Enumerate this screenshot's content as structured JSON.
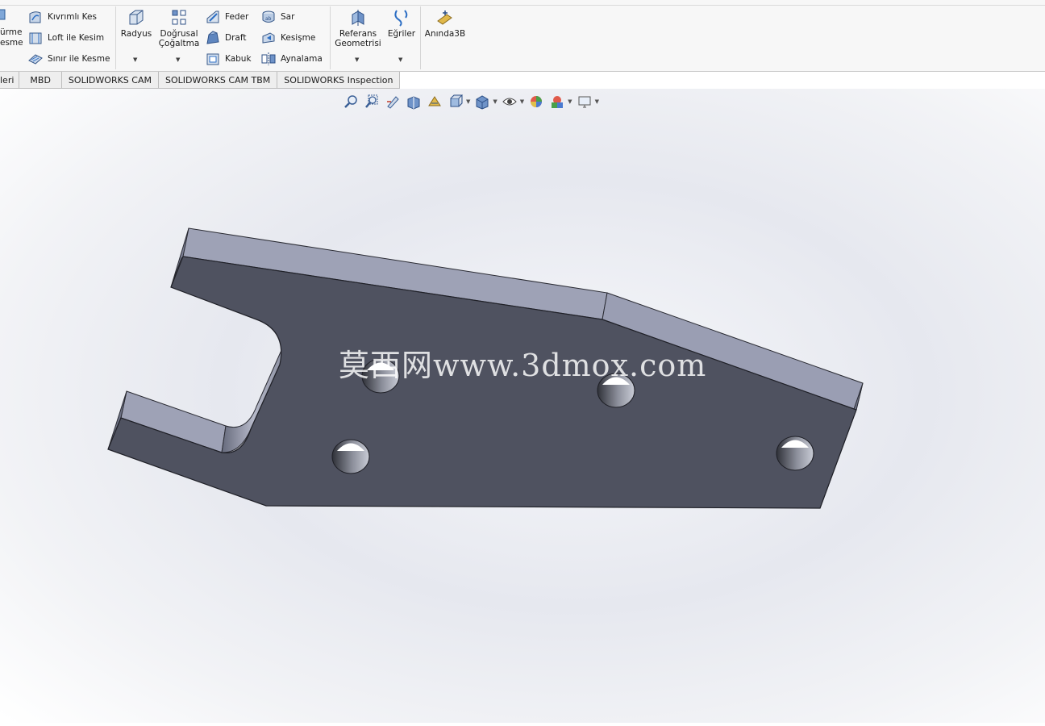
{
  "ribbon": {
    "cut_left_1": "ürme",
    "cut_left_2": "esme",
    "kivrimli_kes": "Kıvrımlı Kes",
    "loft_ile_kesim": "Loft ile Kesim",
    "sinir_ile_kesme": "Sınır ile Kesme",
    "radyus": "Radyus",
    "dogrusal_1": "Doğrusal",
    "dogrusal_2": "Çoğaltma",
    "feder": "Feder",
    "draft": "Draft",
    "kabuk": "Kabuk",
    "sar": "Sar",
    "kesisme": "Kesişme",
    "aynalama": "Aynalama",
    "referans_1": "Referans",
    "referans_2": "Geometrisi",
    "egriler": "Eğriler",
    "aninda3b": "Anında3B"
  },
  "tabs": {
    "items": [
      {
        "label": "leri"
      },
      {
        "label": "MBD"
      },
      {
        "label": "SOLIDWORKS CAM"
      },
      {
        "label": "SOLIDWORKS CAM TBM"
      },
      {
        "label": "SOLIDWORKS Inspection"
      }
    ]
  },
  "viewport": {
    "watermark": "莫西网www.3dmox.com"
  },
  "colors": {
    "ribbon_bg": "#f7f7f7",
    "part_face": "#4f5260",
    "part_top": "#9ea2b6",
    "part_edge": "#7a7e92"
  }
}
